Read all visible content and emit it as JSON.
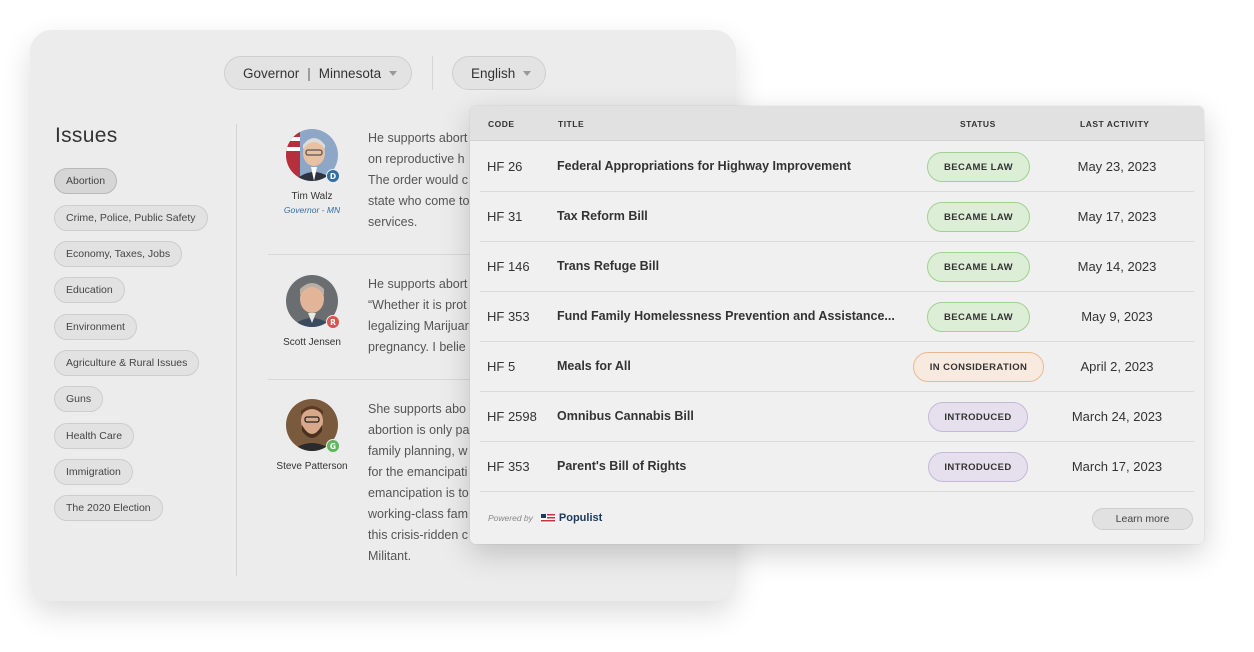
{
  "selectors": {
    "office": "Governor",
    "state": "Minnesota",
    "language": "English"
  },
  "issues": {
    "title": "Issues",
    "items": [
      "Abortion",
      "Crime, Police, Public Safety",
      "Economy, Taxes, Jobs",
      "Education",
      "Environment",
      "Agriculture & Rural Issues",
      "Guns",
      "Health Care",
      "Immigration",
      "The 2020 Election"
    ],
    "active": "Abortion"
  },
  "candidates": [
    {
      "name": "Tim Walz",
      "subtitle": "Governor - MN",
      "party": "D",
      "party_color": "#2f6fa5",
      "statement_lines": [
        "He supports abort",
        "on reproductive h",
        "The order would c",
        "state who come to",
        "services."
      ]
    },
    {
      "name": "Scott Jensen",
      "subtitle": "",
      "party": "R",
      "party_color": "#d9534f",
      "statement_lines": [
        "He supports abort",
        "“Whether it is prot",
        "legalizing Marijuar",
        "pregnancy. I belie"
      ]
    },
    {
      "name": "Steve Patterson",
      "subtitle": "",
      "party": "G",
      "party_color": "#5cb85c",
      "statement_lines": [
        "She supports abo",
        "abortion is only pa",
        "family planning, w",
        "for the emancipati",
        "emancipation is to",
        "working-class fam",
        "this crisis-ridden c",
        "Militant."
      ]
    }
  ],
  "bills_table": {
    "headers": {
      "code": "CODE",
      "title": "TITLE",
      "status": "STATUS",
      "last_activity": "LAST ACTIVITY"
    },
    "rows": [
      {
        "code": "HF 26",
        "title": "Federal Appropriations for Highway Improvement",
        "status": "BECAME LAW",
        "status_kind": "law",
        "date": "May 23, 2023"
      },
      {
        "code": "HF 31",
        "title": "Tax Reform Bill",
        "status": "BECAME LAW",
        "status_kind": "law",
        "date": "May 17, 2023"
      },
      {
        "code": "HF 146",
        "title": "Trans Refuge Bill",
        "status": "BECAME LAW",
        "status_kind": "law",
        "date": "May 14, 2023"
      },
      {
        "code": "HF 353",
        "title": "Fund Family Homelessness Prevention and Assistance...",
        "status": "BECAME LAW",
        "status_kind": "law",
        "date": "May 9, 2023"
      },
      {
        "code": "HF 5",
        "title": "Meals for All",
        "status": "IN CONSIDERATION",
        "status_kind": "consider",
        "date": "April 2, 2023"
      },
      {
        "code": "HF 2598",
        "title": "Omnibus Cannabis Bill",
        "status": "INTRODUCED",
        "status_kind": "intro",
        "date": "March 24, 2023"
      },
      {
        "code": "HF 353",
        "title": "Parent's Bill of Rights",
        "status": "INTRODUCED",
        "status_kind": "intro",
        "date": "March 17, 2023"
      }
    ],
    "footer": {
      "powered_by": "Powered by",
      "brand": "Populist",
      "learn_more": "Learn more"
    }
  }
}
